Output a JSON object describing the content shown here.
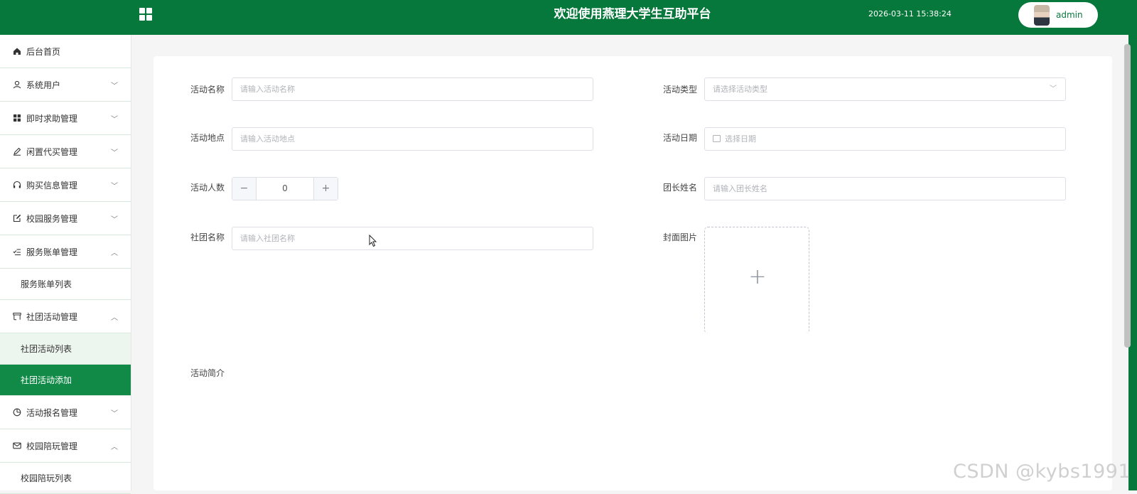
{
  "header": {
    "title": "欢迎使用燕理大学生互助平台",
    "datetime": "2026-03-11 15:38:24",
    "username": "admin",
    "bg_color": "#07783b"
  },
  "sidebar": {
    "home": "后台首页",
    "items": [
      {
        "label": "系统用户",
        "icon": "user-icon",
        "expanded": false
      },
      {
        "label": "即时求助管理",
        "icon": "grid-icon",
        "expanded": false
      },
      {
        "label": "闲置代买管理",
        "icon": "pen-icon",
        "expanded": false
      },
      {
        "label": "购买信息管理",
        "icon": "headset-icon",
        "expanded": false
      },
      {
        "label": "校园服务管理",
        "icon": "edit-icon",
        "expanded": false
      },
      {
        "label": "服务账单管理",
        "icon": "check-list-icon",
        "expanded": true,
        "children": [
          "服务账单列表"
        ]
      },
      {
        "label": "社团活动管理",
        "icon": "shop-icon",
        "expanded": true,
        "children": [
          "社团活动列表",
          "社团活动添加"
        ]
      },
      {
        "label": "活动报名管理",
        "icon": "pie-icon",
        "expanded": false
      },
      {
        "label": "校园陪玩管理",
        "icon": "mail-icon",
        "expanded": true,
        "children": [
          "校园陪玩列表"
        ]
      }
    ]
  },
  "form": {
    "name_label": "活动名称",
    "name_placeholder": "请输入活动名称",
    "type_label": "活动类型",
    "type_placeholder": "请选择活动类型",
    "place_label": "活动地点",
    "place_placeholder": "请输入活动地点",
    "date_label": "活动日期",
    "date_placeholder": "选择日期",
    "count_label": "活动人数",
    "count_value": "0",
    "leader_label": "团长姓名",
    "leader_placeholder": "请输入团长姓名",
    "club_label": "社团名称",
    "club_placeholder": "请输入社团名称",
    "cover_label": "封面图片",
    "intro_label": "活动简介"
  },
  "watermark": "CSDN @kybs1991"
}
